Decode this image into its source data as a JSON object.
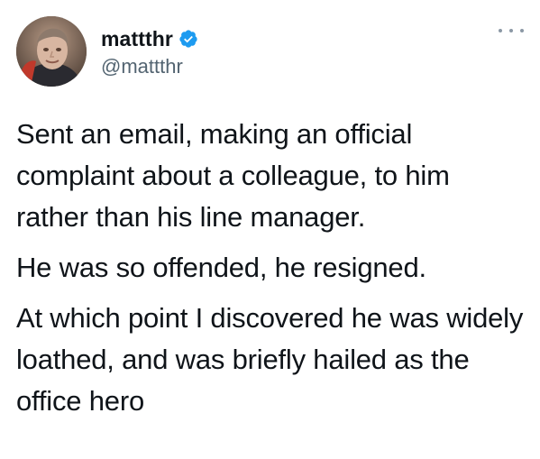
{
  "tweet": {
    "author": {
      "display_name": "mattthr",
      "handle": "@mattthr",
      "verified": true,
      "avatar_icon": "profile-photo"
    },
    "menu_icon": "more-options-icon",
    "paragraphs": [
      "Sent an email, making an official complaint about a colleague, to him rather than his line manager.",
      "He was so offended, he resigned.",
      "At which point I discovered he was widely loathed, and was briefly hailed as the office hero"
    ],
    "colors": {
      "text": "#0f1419",
      "secondary_text": "#536471",
      "verified_blue": "#1d9bf0",
      "background": "#ffffff"
    }
  }
}
